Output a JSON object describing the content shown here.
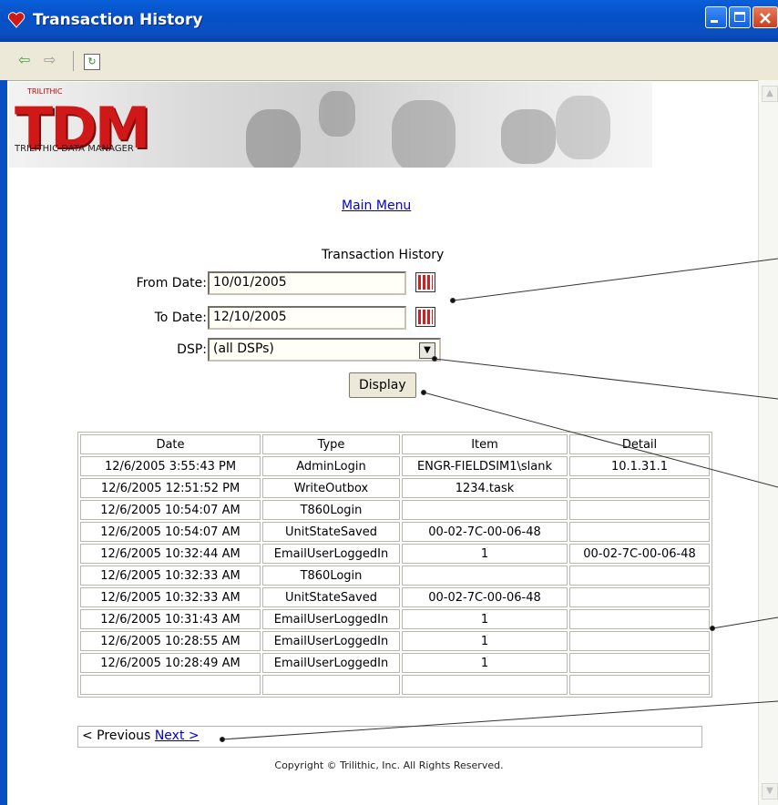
{
  "window": {
    "title": "Transaction History",
    "controls": [
      "minimize",
      "maximize",
      "close"
    ]
  },
  "toolbar": {
    "icons": [
      "back-arrow-icon",
      "forward-arrow-icon",
      "refresh-icon"
    ]
  },
  "banner": {
    "brand": "TRILITHIC",
    "logo": "TDM",
    "tagline": "TRILITHIC DATA MANAGER"
  },
  "nav": {
    "main_menu": "Main Menu"
  },
  "form": {
    "heading": "Transaction History",
    "from_label": "From Date:",
    "from_value": "10/01/2005",
    "to_label": "To Date:",
    "to_value": "12/10/2005",
    "dsp_label": "DSP:",
    "dsp_value": "(all DSPs)",
    "display_button": "Display"
  },
  "table": {
    "headers": [
      "Date",
      "Type",
      "Item",
      "Detail"
    ],
    "rows": [
      [
        "12/6/2005 3:55:43 PM",
        "AdminLogin",
        "ENGR-FIELDSIM1\\slank",
        "10.1.31.1"
      ],
      [
        "12/6/2005 12:51:52 PM",
        "WriteOutbox",
        "1234.task",
        ""
      ],
      [
        "12/6/2005 10:54:07 AM",
        "T860Login",
        "",
        ""
      ],
      [
        "12/6/2005 10:54:07 AM",
        "UnitStateSaved",
        "00-02-7C-00-06-48",
        ""
      ],
      [
        "12/6/2005 10:32:44 AM",
        "EmailUserLoggedIn",
        "1",
        "00-02-7C-00-06-48"
      ],
      [
        "12/6/2005 10:32:33 AM",
        "T860Login",
        "",
        ""
      ],
      [
        "12/6/2005 10:32:33 AM",
        "UnitStateSaved",
        "00-02-7C-00-06-48",
        ""
      ],
      [
        "12/6/2005 10:31:43 AM",
        "EmailUserLoggedIn",
        "1",
        ""
      ],
      [
        "12/6/2005 10:28:55 AM",
        "EmailUserLoggedIn",
        "1",
        ""
      ],
      [
        "12/6/2005 10:28:49 AM",
        "EmailUserLoggedIn",
        "1",
        ""
      ],
      [
        "",
        "",
        "",
        ""
      ]
    ]
  },
  "pager": {
    "previous": "< Previous",
    "next": "Next >"
  },
  "footer": {
    "copyright": "Copyright © Trilithic, Inc. All Rights Reserved."
  },
  "colors": {
    "titlebar": "#0a4fc2",
    "logo_red": "#d01818",
    "link": "#0000cc"
  }
}
